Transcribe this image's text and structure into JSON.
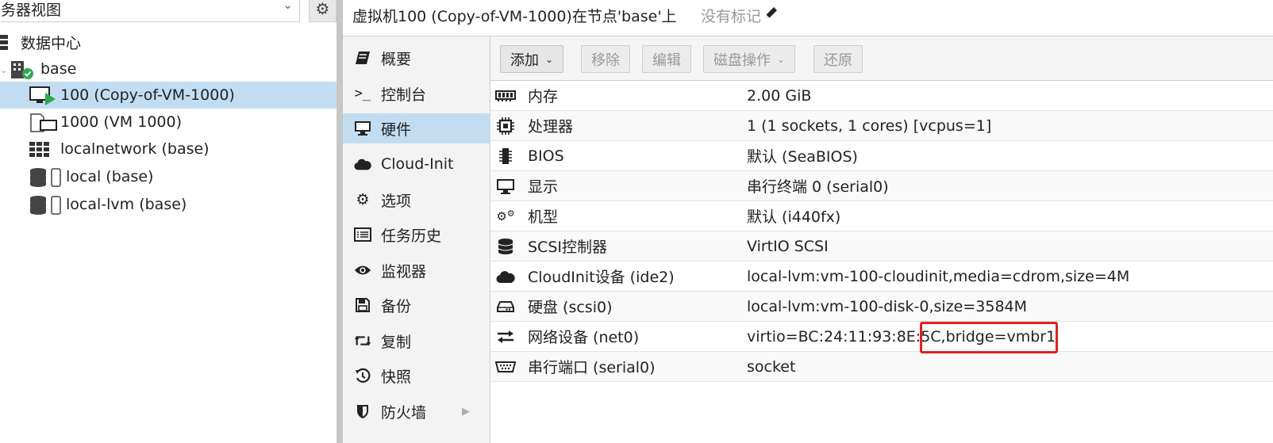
{
  "tree": {
    "view_label": "务器视图",
    "items": [
      {
        "label": "数据中心"
      },
      {
        "label": "base"
      },
      {
        "label": "100 (Copy-of-VM-1000)"
      },
      {
        "label": "1000 (VM 1000)"
      },
      {
        "label": "localnetwork (base)"
      },
      {
        "label": "local (base)"
      },
      {
        "label": "local-lvm (base)"
      }
    ]
  },
  "header": {
    "title": "虚拟机100 (Copy-of-VM-1000)在节点'base'上",
    "tags": "没有标记"
  },
  "nav": {
    "items": [
      {
        "label": "概要",
        "icon": "book-icon"
      },
      {
        "label": "控制台",
        "icon": "terminal-icon"
      },
      {
        "label": "硬件",
        "icon": "desktop-icon"
      },
      {
        "label": "Cloud-Init",
        "icon": "cloud-icon"
      },
      {
        "label": "选项",
        "icon": "gear-icon"
      },
      {
        "label": "任务历史",
        "icon": "list-icon"
      },
      {
        "label": "监视器",
        "icon": "eye-icon"
      },
      {
        "label": "备份",
        "icon": "floppy-icon"
      },
      {
        "label": "复制",
        "icon": "retweet-icon"
      },
      {
        "label": "快照",
        "icon": "history-icon"
      },
      {
        "label": "防火墙",
        "icon": "shield-icon"
      }
    ]
  },
  "toolbar": {
    "add": "添加",
    "remove": "移除",
    "edit": "编辑",
    "disk_action": "磁盘操作",
    "revert": "还原"
  },
  "hardware": [
    {
      "name": "内存",
      "value": "2.00 GiB",
      "icon": "memory-icon"
    },
    {
      "name": "处理器",
      "value": "1 (1 sockets, 1 cores) [vcpus=1]",
      "icon": "cpu-icon"
    },
    {
      "name": "BIOS",
      "value": "默认 (SeaBIOS)",
      "icon": "microchip-icon"
    },
    {
      "name": "显示",
      "value": "串行终端 0 (serial0)",
      "icon": "desktop-icon"
    },
    {
      "name": "机型",
      "value": "默认 (i440fx)",
      "icon": "cogs-icon"
    },
    {
      "name": "SCSI控制器",
      "value": "VirtIO SCSI",
      "icon": "database-icon"
    },
    {
      "name": "CloudInit设备 (ide2)",
      "value": "local-lvm:vm-100-cloudinit,media=cdrom,size=4M",
      "icon": "cloud-icon"
    },
    {
      "name": "硬盘 (scsi0)",
      "value": "local-lvm:vm-100-disk-0,size=3584M",
      "icon": "hdd-icon"
    },
    {
      "name": "网络设备 (net0)",
      "value": "virtio=BC:24:11:93:8E:5C,bridge=vmbr1",
      "icon": "exchange-icon"
    },
    {
      "name": "串行端口 (serial0)",
      "value": "socket",
      "icon": "serial-port-icon"
    }
  ]
}
